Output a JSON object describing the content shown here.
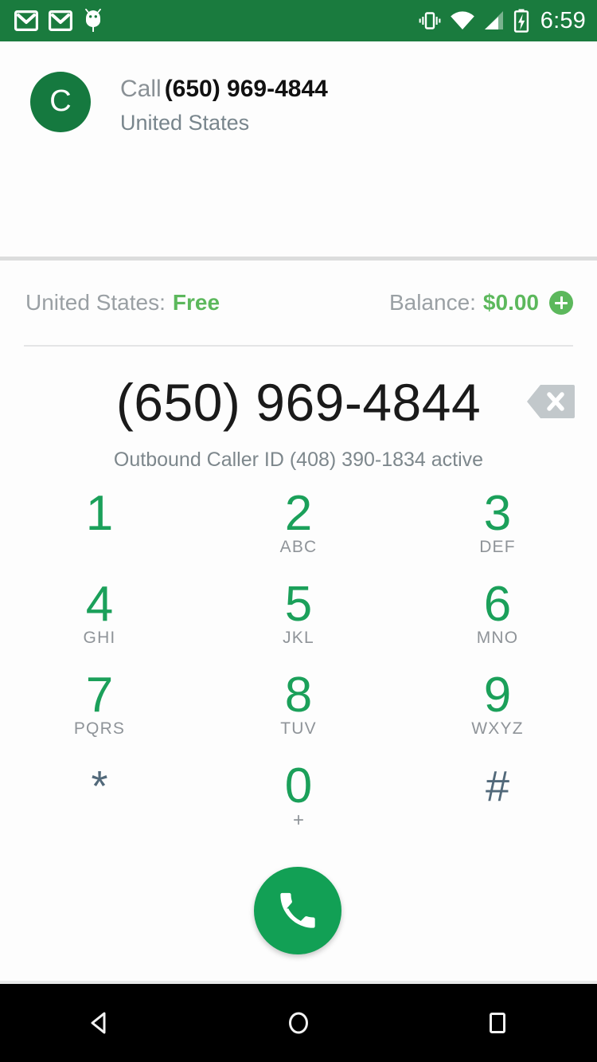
{
  "status_bar": {
    "background_color": "#1a7b3e",
    "clock": "6:59",
    "left_icons": [
      "gmail-icon",
      "gmail-icon",
      "android-debug-icon"
    ],
    "right_icons": [
      "vibrate-icon",
      "wifi-icon",
      "cellular-signal-icon",
      "battery-charging-icon"
    ]
  },
  "call_header": {
    "avatar_letter": "C",
    "avatar_color": "#15793f",
    "call_prefix": "Call",
    "phone_number": "(650) 969-4844",
    "country": "United States"
  },
  "rate_row": {
    "rate_label": "United States:",
    "rate_value": "Free",
    "rate_value_color": "#5cb85c",
    "balance_label": "Balance:",
    "balance_value": "$0.00",
    "balance_value_color": "#5cb85c",
    "add_credit_icon": "plus-circle-icon"
  },
  "dialer": {
    "dialed_number": "(650) 969-4844",
    "backspace_icon": "backspace-icon",
    "caller_id_note": "Outbound Caller ID (408) 390-1834 active",
    "keypad_digit_color": "#1ba05a",
    "keys": [
      {
        "digit": "1",
        "letters": ""
      },
      {
        "digit": "2",
        "letters": "ABC"
      },
      {
        "digit": "3",
        "letters": "DEF"
      },
      {
        "digit": "4",
        "letters": "GHI"
      },
      {
        "digit": "5",
        "letters": "JKL"
      },
      {
        "digit": "6",
        "letters": "MNO"
      },
      {
        "digit": "7",
        "letters": "PQRS"
      },
      {
        "digit": "8",
        "letters": "TUV"
      },
      {
        "digit": "9",
        "letters": "WXYZ"
      },
      {
        "digit": "*",
        "letters": ""
      },
      {
        "digit": "0",
        "letters": "+"
      },
      {
        "digit": "#",
        "letters": ""
      }
    ],
    "call_button_icon": "phone-handset-icon",
    "call_button_color": "#12a055"
  },
  "nav_bar": {
    "background_color": "#000000",
    "buttons": [
      "back-triangle-icon",
      "home-circle-icon",
      "recents-square-icon"
    ]
  }
}
